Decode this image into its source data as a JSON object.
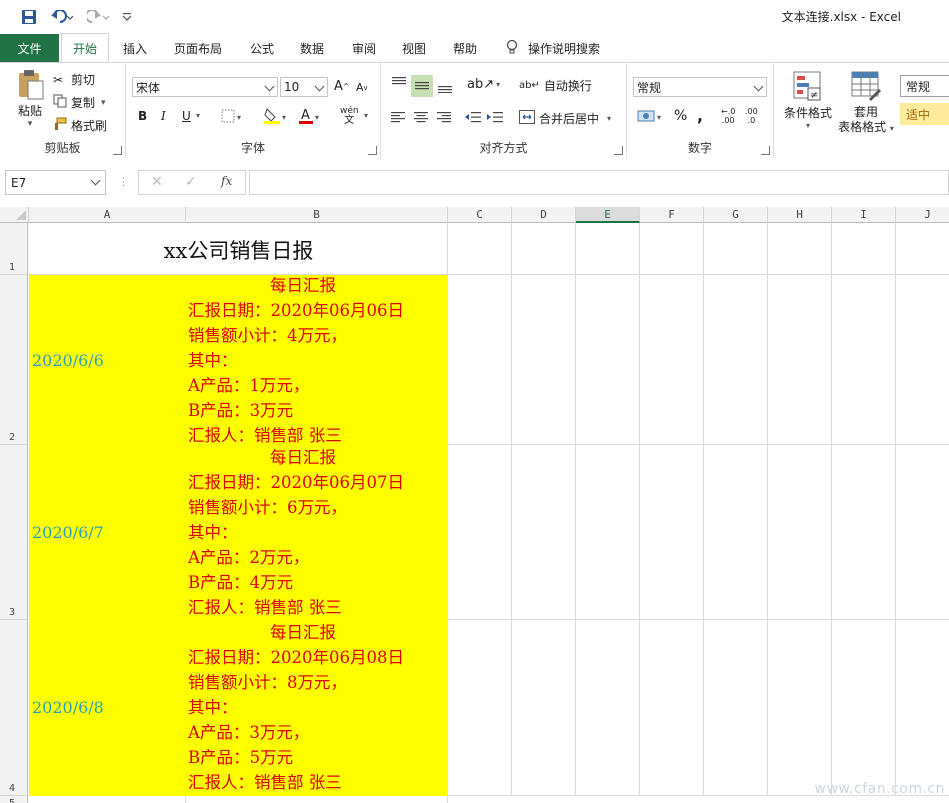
{
  "window": {
    "title": "文本连接.xlsx  -  Excel"
  },
  "tabs": [
    "文件",
    "开始",
    "插入",
    "页面布局",
    "公式",
    "数据",
    "审阅",
    "视图",
    "帮助"
  ],
  "tell_me": "操作说明搜索",
  "ribbon": {
    "clipboard": {
      "paste": "粘贴",
      "cut": "剪切",
      "copy": "复制",
      "format_painter": "格式刷",
      "label": "剪贴板"
    },
    "font": {
      "name": "宋体",
      "size": "10",
      "bold": "B",
      "italic": "I",
      "underline": "U",
      "phonetic": "wén",
      "label": "字体"
    },
    "alignment": {
      "wrap_text": "自动换行",
      "merge_center": "合并后居中",
      "label": "对齐方式"
    },
    "number": {
      "format": "常规",
      "percent": "%",
      "comma": ",",
      "inc_decimal": ".00",
      "dec_decimal": ".0",
      "label": "数字"
    },
    "styles": {
      "conditional": "条件格式",
      "table_format_1": "套用",
      "table_format_2": "表格格式",
      "normal": "常规",
      "neutral": "适中"
    }
  },
  "formula_bar": {
    "name_box": "E7",
    "fx": "fx",
    "formula": ""
  },
  "columns": [
    "A",
    "B",
    "C",
    "D",
    "E",
    "F",
    "G",
    "H",
    "I",
    "J"
  ],
  "rows": [
    "1",
    "2",
    "3",
    "4",
    "5"
  ],
  "sheet": {
    "title": "xx公司销售日报",
    "entries": [
      {
        "date": "2020/6/6",
        "lines": [
          "每日汇报",
          "汇报日期：2020年06月06日",
          "销售额小计：4万元，",
          "其中：",
          "A产品：1万元，",
          "B产品：3万元",
          "汇报人：销售部 张三"
        ]
      },
      {
        "date": "2020/6/7",
        "lines": [
          "每日汇报",
          "汇报日期：2020年06月07日",
          "销售额小计：6万元，",
          "其中：",
          "A产品：2万元，",
          "B产品：4万元",
          "汇报人：销售部 张三"
        ]
      },
      {
        "date": "2020/6/8",
        "lines": [
          "每日汇报",
          "汇报日期：2020年06月08日",
          "销售额小计：8万元，",
          "其中：",
          "A产品：3万元，",
          "B产品：5万元",
          "汇报人：销售部 张三"
        ]
      }
    ]
  },
  "watermark": "www.cfan.com.cn",
  "colors": {
    "accent": "#217346",
    "cell_fill": "#ffff00",
    "report_text": "#e00000",
    "date_text": "#2aa0b8"
  }
}
